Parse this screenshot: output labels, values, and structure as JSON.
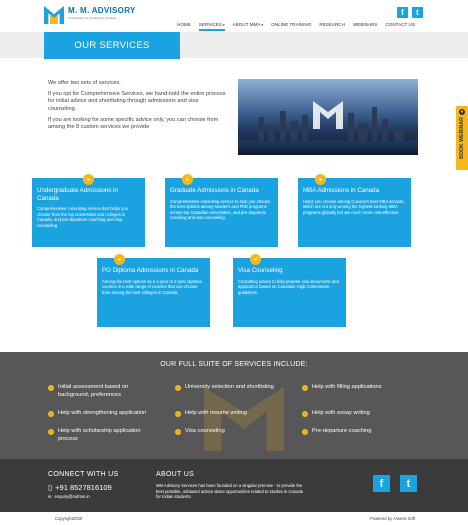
{
  "brand": {
    "name": "M. M. ADVISORY",
    "tagline": "Consultation for studying in Canada"
  },
  "colors": {
    "accent": "#1aa3e0",
    "yellow": "#f5b81b",
    "dark": "#575757",
    "footer": "#3b3b3b"
  },
  "nav": [
    {
      "label": "HOME",
      "active": false,
      "dropdown": false
    },
    {
      "label": "SERVICES",
      "active": true,
      "dropdown": true
    },
    {
      "label": "ABOUT MMA",
      "active": false,
      "dropdown": true
    },
    {
      "label": "ONLINE TRAINING",
      "active": false,
      "dropdown": false
    },
    {
      "label": "RESEARCH",
      "active": false,
      "dropdown": false
    },
    {
      "label": "WEBINARS",
      "active": false,
      "dropdown": false
    },
    {
      "label": "CONTACT US",
      "active": false,
      "dropdown": false
    }
  ],
  "social_icons": [
    "facebook-icon",
    "twitter-icon"
  ],
  "page_title": "OUR SERVICES",
  "intro": [
    "We offer two sets of services.",
    "If you opt for Comprehensive Services, we hand-hold the entire process for initial advice and shortlisting through admissions and visa counseling.",
    "If you are looking for some specific advice only, you can choose from among the 8 custom services we provide"
  ],
  "services": [
    {
      "title": "Undergraduate Admissions in Canada",
      "text": "Comprehensive consulting service that helps you choose from the top universities and colleges in Canada, and pre-departure coaching and visa counseling"
    },
    {
      "title": "Graduate Admissions in Canada",
      "text": "Comprehensive consulting service to help you choose the best options among Master's and PhD programs across top Canadian universities, and pre-departure coaching and visa counseling."
    },
    {
      "title": "MBA Admissions in Canada",
      "text": "Helps you choose among Canada's best MBA schools, which are not only among the highest-ranking MBA programs globally but are much more cost-effective."
    },
    {
      "title": "PG Diploma Admissions in Canada",
      "text": "Among the best options as a 1-year or 2-year diploma courses in a wide range of courses that can choose from among the best colleges in Canada."
    },
    {
      "title": "Visa Counseling",
      "text": "Consulting advice to help prepare visa documents and application based on Canadian High Commission guidelines."
    }
  ],
  "suite": {
    "title": "OUR FULL SUITE OF SERVICES INCLUDE:",
    "items": [
      "Initial assessment based on background, preferences",
      "University selection and shortlisting",
      "Help with filling applications",
      "Help with strengthening application",
      "Help with resume writing",
      "Help with essay writing",
      "Help with scholarship application process",
      "Visa counseling",
      "Pre-departure coaching"
    ]
  },
  "footer": {
    "connect_title": "CONNECT WITH US",
    "phone": "+91 8527816109",
    "email": "enquiry@mdmm.in",
    "about_title": "ABOUT US",
    "about_text": "MM Advisory Services has been founded on a singular premise - to provide the best possible, unbiased advice about opportunities related to studies in Canada for Indian students."
  },
  "copyright": "Copyright2020",
  "powered_by": "Powered by Assess Soft",
  "book_webinar": "BOOK WEBINAR"
}
